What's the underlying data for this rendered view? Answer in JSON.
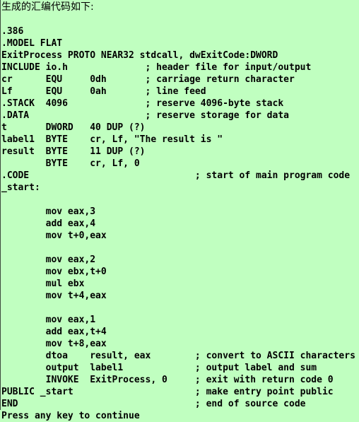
{
  "window": {
    "background_color": "#c0ffc0",
    "text_color": "#000000",
    "rule_color": "#3c4a3c"
  },
  "header": {
    "text": "生成的汇编代码如下:"
  },
  "code": {
    "language": "x86-assembly-masm",
    "char_columns": 63,
    "comment_column_a": 23,
    "comment_column_b": 32,
    "lines": [
      ".386",
      ".MODEL FLAT",
      "ExitProcess PROTO NEAR32 stdcall, dwExitCode:DWORD",
      "INCLUDE io.h              ; header file for input/output",
      "cr      EQU     0dh       ; carriage return character",
      "Lf      EQU     0ah       ; line feed",
      ".STACK  4096              ; reserve 4096-byte stack",
      ".DATA                     ; reserve storage for data",
      "t       DWORD   40 DUP (?)",
      "label1  BYTE    cr, Lf, \"The result is \"",
      "result  BYTE    11 DUP (?)",
      "        BYTE    cr, Lf, 0",
      ".CODE                              ; start of main program code",
      "_start:",
      "",
      "        mov eax,3",
      "        add eax,4",
      "        mov t+0,eax",
      "",
      "        mov eax,2",
      "        mov ebx,t+0",
      "        mul ebx",
      "        mov t+4,eax",
      "",
      "        mov eax,1",
      "        add eax,t+4",
      "        mov t+8,eax",
      "        dtoa    result, eax        ; convert to ASCII characters",
      "        output  label1             ; output label and sum",
      "        INVOKE  ExitProcess, 0     ; exit with return code 0",
      "PUBLIC _start                      ; make entry point public",
      "END                                ; end of source code",
      "Press any key to continue"
    ]
  }
}
